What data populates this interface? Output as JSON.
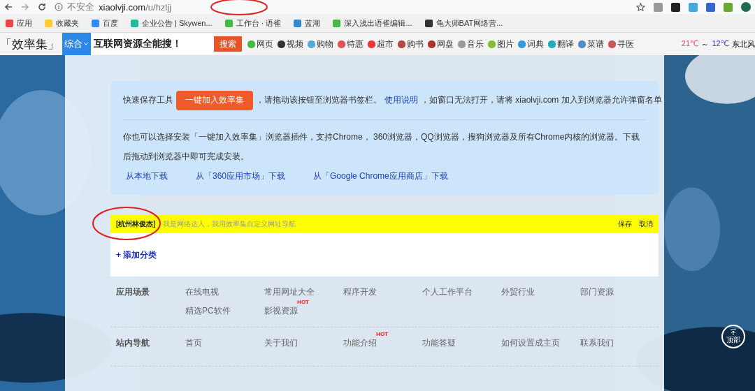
{
  "browser": {
    "security": "不安全",
    "domain": "xiaolvji.com",
    "path": "/u/hzljj"
  },
  "bookmarks": [
    {
      "label": "应用"
    },
    {
      "label": "收藏夹"
    },
    {
      "label": "百度"
    },
    {
      "label": "企业公告 | Skywen..."
    },
    {
      "label": "工作台 · 语雀"
    },
    {
      "label": "蓝湖"
    },
    {
      "label": "深入浅出语雀编辑..."
    },
    {
      "label": "龟大师BAT网络营..."
    }
  ],
  "search_bar": {
    "logo": "「效率集」",
    "category": "综合",
    "query": "互联网资源全能搜！",
    "button": "搜索",
    "links": [
      {
        "label": "网页"
      },
      {
        "label": "视频"
      },
      {
        "label": "购物"
      },
      {
        "label": "特惠"
      },
      {
        "label": "超市"
      },
      {
        "label": "购书"
      },
      {
        "label": "网盘"
      },
      {
        "label": "音乐"
      },
      {
        "label": "图片"
      },
      {
        "label": "词典"
      },
      {
        "label": "翻译"
      },
      {
        "label": "菜谱"
      },
      {
        "label": "寻医"
      }
    ],
    "weather": {
      "high": "21℃",
      "separator": "～",
      "low": "12℃",
      "wind": "东北风"
    }
  },
  "info_box": {
    "lead": "快速保存工具",
    "button": "一键加入效率集",
    "middle": "，请拖动该按钮至浏览器书签栏。",
    "help_link": "使用说明",
    "tail": "，如窗口无法打开，请将 xiaolvji.com 加入到浏览器允许弹窗名单",
    "paragraph": "你也可以选择安装「一键加入效率集」浏览器插件，支持Chrome， 360浏览器，QQ浏览器，搜狗浏览器及所有Chrome内核的浏览器。下载后拖动到浏览器中即可完成安装。",
    "downloads": [
      {
        "label": "从本地下载"
      },
      {
        "label": "从「360应用市场」下载"
      },
      {
        "label": "从「Google Chrome应用商店」下载"
      }
    ]
  },
  "custom_nav": {
    "name": "[杭州林俊杰]",
    "slogan": "，我是网络达人，我用效率集自定义网址导航",
    "actions": [
      {
        "label": "保存"
      },
      {
        "label": "取消"
      }
    ],
    "add_category": "+ 添加分类"
  },
  "site_links": [
    {
      "title": "应用场景",
      "items": [
        {
          "label": "在线电视"
        },
        {
          "label": "常用网址大全"
        },
        {
          "label": "程序开发"
        },
        {
          "label": "个人工作平台"
        },
        {
          "label": "外贸行业"
        },
        {
          "label": "部门资源"
        },
        {
          "label": "精选PC软件"
        },
        {
          "label": "影视资源",
          "badge": "HOT"
        }
      ]
    },
    {
      "title": "站内导航",
      "items": [
        {
          "label": "首页"
        },
        {
          "label": "关于我们"
        },
        {
          "label": "功能介绍",
          "badge": "HOT"
        },
        {
          "label": "功能答疑"
        },
        {
          "label": "如何设置成主页"
        },
        {
          "label": "联系我们"
        }
      ]
    }
  ],
  "back_to_top": "顶部"
}
